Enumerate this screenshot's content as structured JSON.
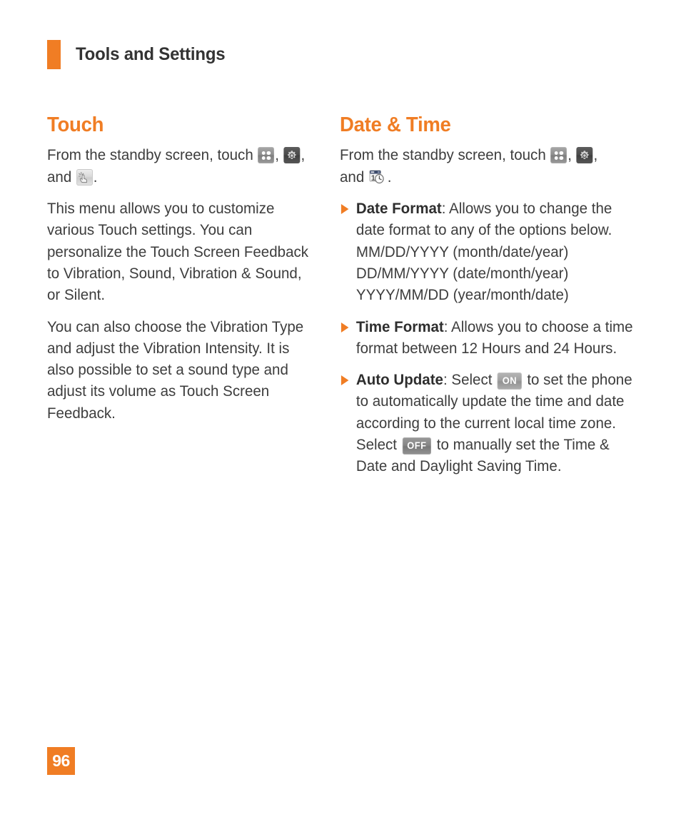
{
  "header": {
    "title": "Tools and Settings",
    "accent_color": "#F07D24"
  },
  "left_column": {
    "section_title": "Touch",
    "intro_prefix": "From the standby screen, touch ",
    "intro_sep1": ", ",
    "intro_sep2": ", and ",
    "intro_suffix": ".",
    "icons": [
      "grid-icon",
      "gear-icon",
      "touch-icon"
    ],
    "paragraphs": [
      "This menu allows you to customize various Touch settings. You can personalize the Touch Screen Feedback to Vibration, Sound, Vibration & Sound, or Silent.",
      "You can also choose the Vibration Type and adjust the Vibration  Intensity. It is also possible to set a sound type and adjust its volume as Touch Screen Feedback."
    ]
  },
  "right_column": {
    "section_title": "Date & Time",
    "intro_prefix": "From the standby screen, touch ",
    "intro_sep1": ", ",
    "intro_sep2": ", and ",
    "intro_suffix": ".",
    "icons": [
      "grid-icon",
      "gear-icon",
      "calendar-clock-icon"
    ],
    "bullets": [
      {
        "term": "Date Format",
        "text": ": Allows you to change the date format to any of the options below.",
        "formats": [
          "MM/DD/YYYY (month/date/year)",
          "DD/MM/YYYY (date/month/year)",
          "YYYY/MM/DD (year/month/date)"
        ]
      },
      {
        "term": "Time Format",
        "text": ": Allows you to choose a time format between 12 Hours and 24 Hours."
      },
      {
        "term": "Auto Update",
        "text_a": ": Select ",
        "badge_on": "ON",
        "text_b": " to set the phone to automatically update the time and date according to the current local time zone. Select ",
        "badge_off": "OFF",
        "text_c": " to manually set the Time & Date and Daylight Saving Time."
      }
    ]
  },
  "footer": {
    "page_number": "96"
  }
}
